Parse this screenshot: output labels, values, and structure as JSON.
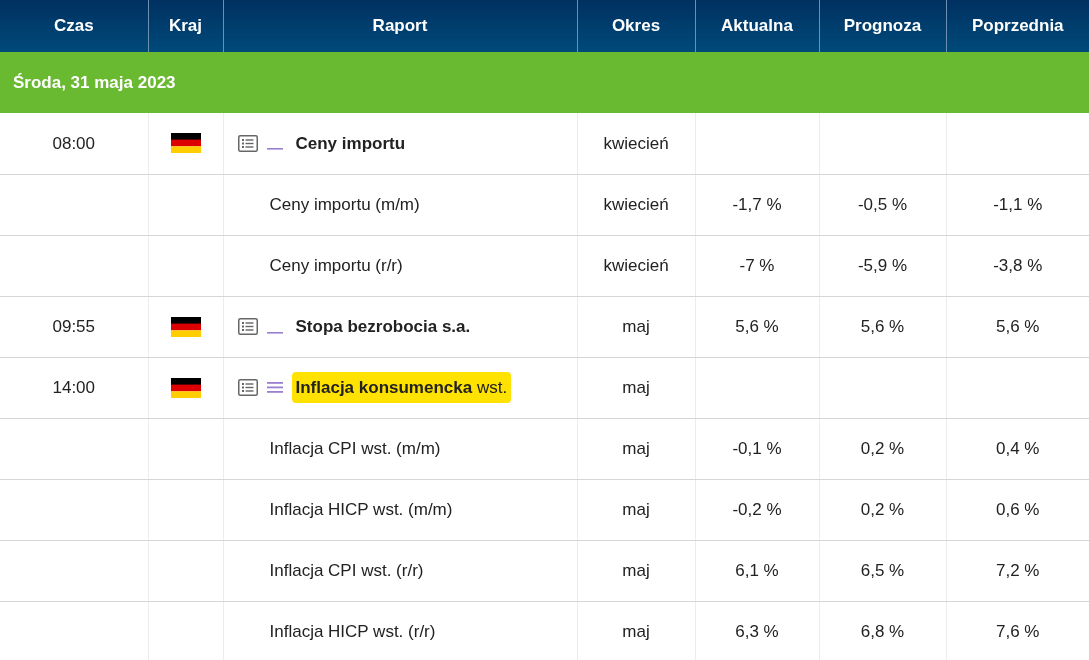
{
  "columns": [
    "Czas",
    "Kraj",
    "Raport",
    "Okres",
    "Aktualna",
    "Prognoza",
    "Poprzednia"
  ],
  "date_header": "Środa, 31 maja 2023",
  "rows": [
    {
      "kind": "main",
      "time": "08:00",
      "high_importance": false,
      "title": "Ceny importu",
      "highlighted": false,
      "period": "kwiecień",
      "actual": "",
      "forecast": "",
      "previous": ""
    },
    {
      "kind": "sub",
      "title": "Ceny importu (m/m)",
      "period": "kwiecień",
      "actual": "-1,7 %",
      "forecast": "-0,5 %",
      "previous": "-1,1 %"
    },
    {
      "kind": "sub",
      "title": "Ceny importu (r/r)",
      "period": "kwiecień",
      "actual": "-7 %",
      "forecast": "-5,9 %",
      "previous": "-3,8 %"
    },
    {
      "kind": "main",
      "time": "09:55",
      "high_importance": false,
      "title": "Stopa bezrobocia s.a.",
      "highlighted": false,
      "period": "maj",
      "actual": "5,6 %",
      "forecast": "5,6 %",
      "previous": "5,6 %"
    },
    {
      "kind": "main",
      "time": "14:00",
      "high_importance": true,
      "title": "Inflacja konsumencka",
      "suffix": "wst.",
      "highlighted": true,
      "period": "maj",
      "actual": "",
      "forecast": "",
      "previous": ""
    },
    {
      "kind": "sub",
      "title": "Inflacja CPI wst. (m/m)",
      "period": "maj",
      "actual": "-0,1 %",
      "forecast": "0,2 %",
      "previous": "0,4 %"
    },
    {
      "kind": "sub",
      "title": "Inflacja HICP wst. (m/m)",
      "period": "maj",
      "actual": "-0,2 %",
      "forecast": "0,2 %",
      "previous": "0,6 %"
    },
    {
      "kind": "sub",
      "title": "Inflacja CPI wst. (r/r)",
      "period": "maj",
      "actual": "6,1 %",
      "forecast": "6,5 %",
      "previous": "7,2 %"
    },
    {
      "kind": "sub",
      "title": "Inflacja HICP wst. (r/r)",
      "period": "maj",
      "actual": "6,3 %",
      "forecast": "6,8 %",
      "previous": "7,6 %"
    }
  ]
}
